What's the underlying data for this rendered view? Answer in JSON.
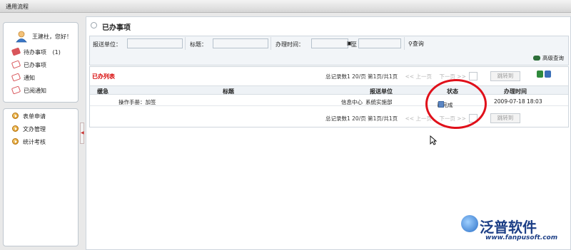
{
  "app": {
    "title": "通用流程"
  },
  "user": {
    "greeting": "王建柱，您好！"
  },
  "nav": {
    "items": [
      {
        "label": "待办事项",
        "count": "(1)"
      },
      {
        "label": "已办事项"
      },
      {
        "label": "通知"
      },
      {
        "label": "已阅通知"
      }
    ]
  },
  "menu": {
    "items": [
      {
        "label": "表单申请"
      },
      {
        "label": "文办管理"
      },
      {
        "label": "统计考核"
      }
    ]
  },
  "page": {
    "title": "已办事项"
  },
  "filters": {
    "unit_label": "报送单位：",
    "title_label": "标题：",
    "time_label": "办理时间：",
    "to_label": "至",
    "search_label": "查询",
    "advanced_label": "高级查询"
  },
  "list": {
    "title": "已办列表",
    "pager_info": "总记录数1  20/页  第1页/共1页",
    "prev": "<< 上一页",
    "next": "下一页 >>",
    "page_value": "1",
    "jump": "跳转到",
    "columns": [
      "缓急",
      "标题",
      "报送单位",
      "状态",
      "办理时间"
    ],
    "rows": [
      {
        "urgency": "",
        "title": "操作手册：加签",
        "unit_dept": "信息中心",
        "unit_sub": "系统实施部",
        "status": "已完成",
        "time": "2009-07-18 18:03"
      }
    ]
  },
  "watermark": {
    "brand": "泛普软件",
    "url": "www.fanpusoft.com"
  },
  "colors": {
    "accent_red": "#d60000",
    "circle": "#e0101a",
    "brand_blue": "#1d3f86"
  }
}
